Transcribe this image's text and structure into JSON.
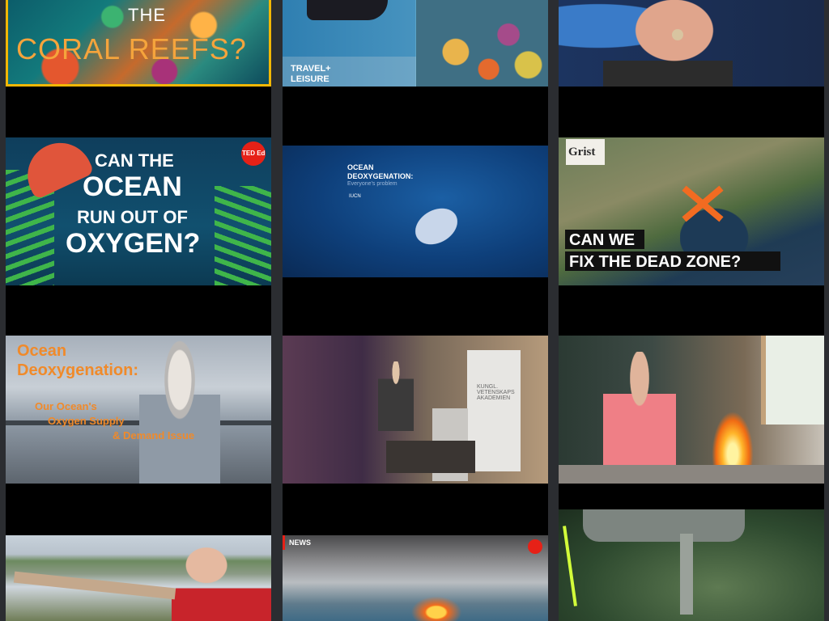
{
  "videos": [
    {
      "id": "v1",
      "title_lines": [
        "THE",
        "CORAL REEFS?"
      ]
    },
    {
      "id": "v2",
      "brand_top": "TRAVEL+",
      "brand_bottom": "LEISURE"
    },
    {
      "id": "v3"
    },
    {
      "id": "v4",
      "title_lines": [
        "CAN THE",
        "OCEAN",
        "RUN OUT OF",
        "OXYGEN?"
      ],
      "badge": "TED Ed"
    },
    {
      "id": "v5",
      "title_lines": [
        "OCEAN",
        "DEOXYGENATION:"
      ],
      "subtitle": "Everyone's problem",
      "logo": "IUCN"
    },
    {
      "id": "v6",
      "brand": "Grist",
      "title_lines": [
        "CAN WE",
        "FIX THE DEAD ZONE?"
      ]
    },
    {
      "id": "v7",
      "title_lines": [
        "Ocean",
        "Deoxygenation:"
      ],
      "subtitle_lines": [
        "Our Ocean's",
        "Oxygen Supply",
        "& Demand Issue"
      ]
    },
    {
      "id": "v8",
      "sign": "KUNGL. VETENSKAPS AKADEMIEN"
    },
    {
      "id": "v9"
    },
    {
      "id": "v10"
    },
    {
      "id": "v11",
      "tag": "NEWS"
    },
    {
      "id": "v12"
    }
  ],
  "colors": {
    "page_bg": "#2b2d31",
    "selected_border": "#f2b705",
    "orange_title": "#f08a2a",
    "red_badge": "#e62117"
  }
}
